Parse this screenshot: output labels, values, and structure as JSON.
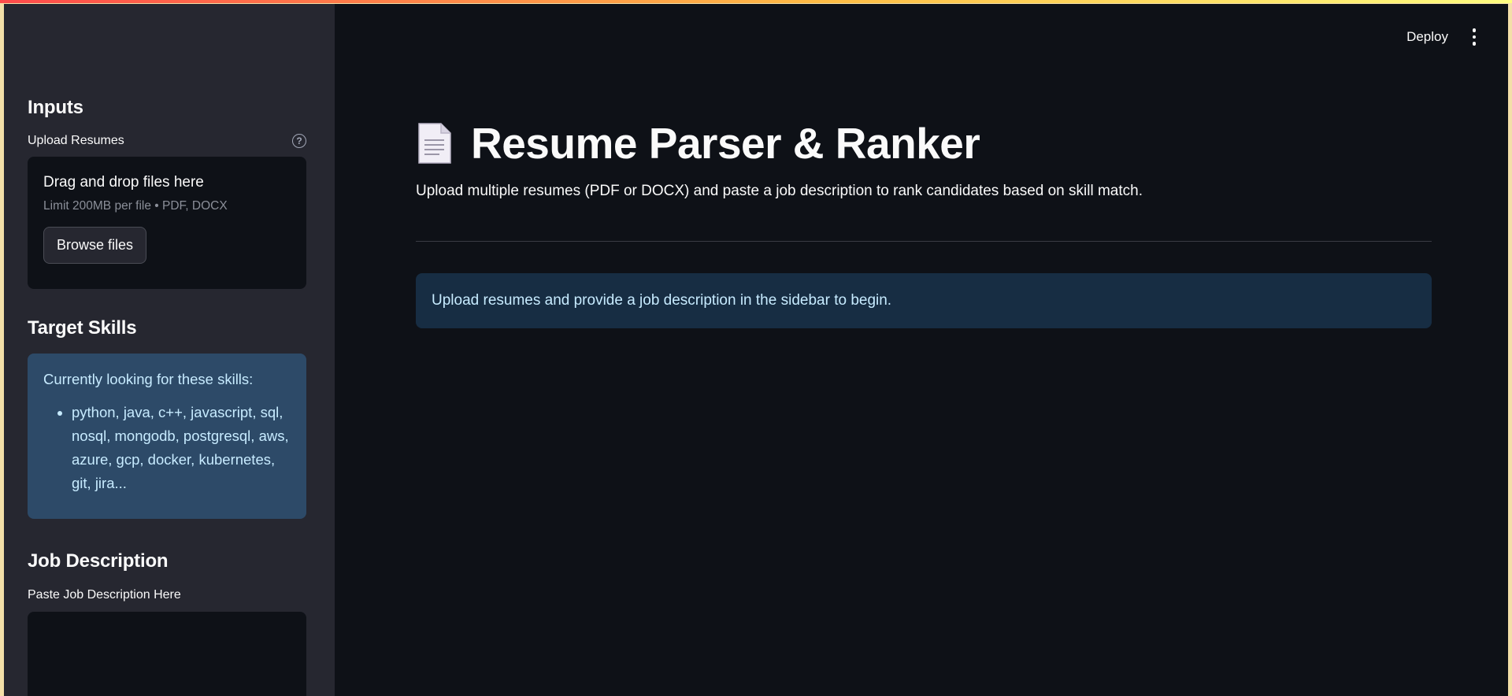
{
  "header": {
    "deploy_label": "Deploy"
  },
  "sidebar": {
    "inputs_heading": "Inputs",
    "upload": {
      "label": "Upload Resumes",
      "dropzone_title": "Drag and drop files here",
      "dropzone_limit": "Limit 200MB per file • PDF, DOCX",
      "browse_label": "Browse files"
    },
    "skills": {
      "heading": "Target Skills",
      "intro": "Currently looking for these skills:",
      "items": [
        "python, java, c++, javascript, sql, nosql, mongodb, postgresql, aws, azure, gcp, docker, kubernetes, git, jira..."
      ]
    },
    "job_description": {
      "heading": "Job Description",
      "label": "Paste Job Description Here"
    }
  },
  "main": {
    "title": "Resume Parser & Ranker",
    "subtitle": "Upload multiple resumes (PDF or DOCX) and paste a job description to rank candidates based on skill match.",
    "info_message": "Upload resumes and provide a job description in the sidebar to begin."
  },
  "colors": {
    "background": "#0e1117",
    "sidebar": "#262730",
    "info_bg": "#172d43",
    "info_text": "#c7ebff"
  }
}
